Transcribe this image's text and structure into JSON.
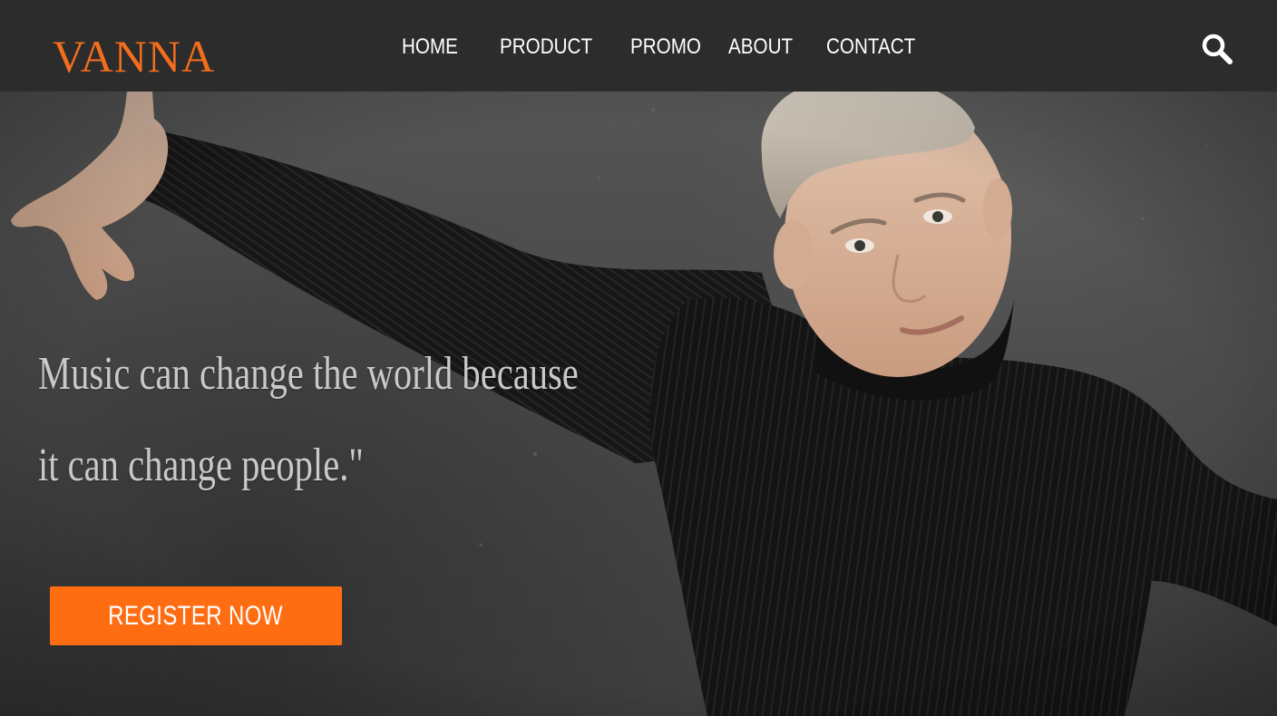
{
  "header": {
    "logo": "VANNA",
    "nav": [
      {
        "label": "HOME"
      },
      {
        "label": "PRODUCT"
      },
      {
        "label": "PROMO"
      },
      {
        "label": "ABOUT"
      },
      {
        "label": "CONTACT"
      }
    ],
    "search_icon": "search-icon"
  },
  "hero": {
    "quote_line1": "Music can change the world because",
    "quote_line2": "it can change people.\"",
    "register_label": "REGISTER NOW"
  },
  "colors": {
    "accent": "#f26d1d",
    "button": "#ff6d12",
    "navbar": "#2b2c2b",
    "nav_text": "#ffffff",
    "quote_text": "#c9c9c9"
  }
}
